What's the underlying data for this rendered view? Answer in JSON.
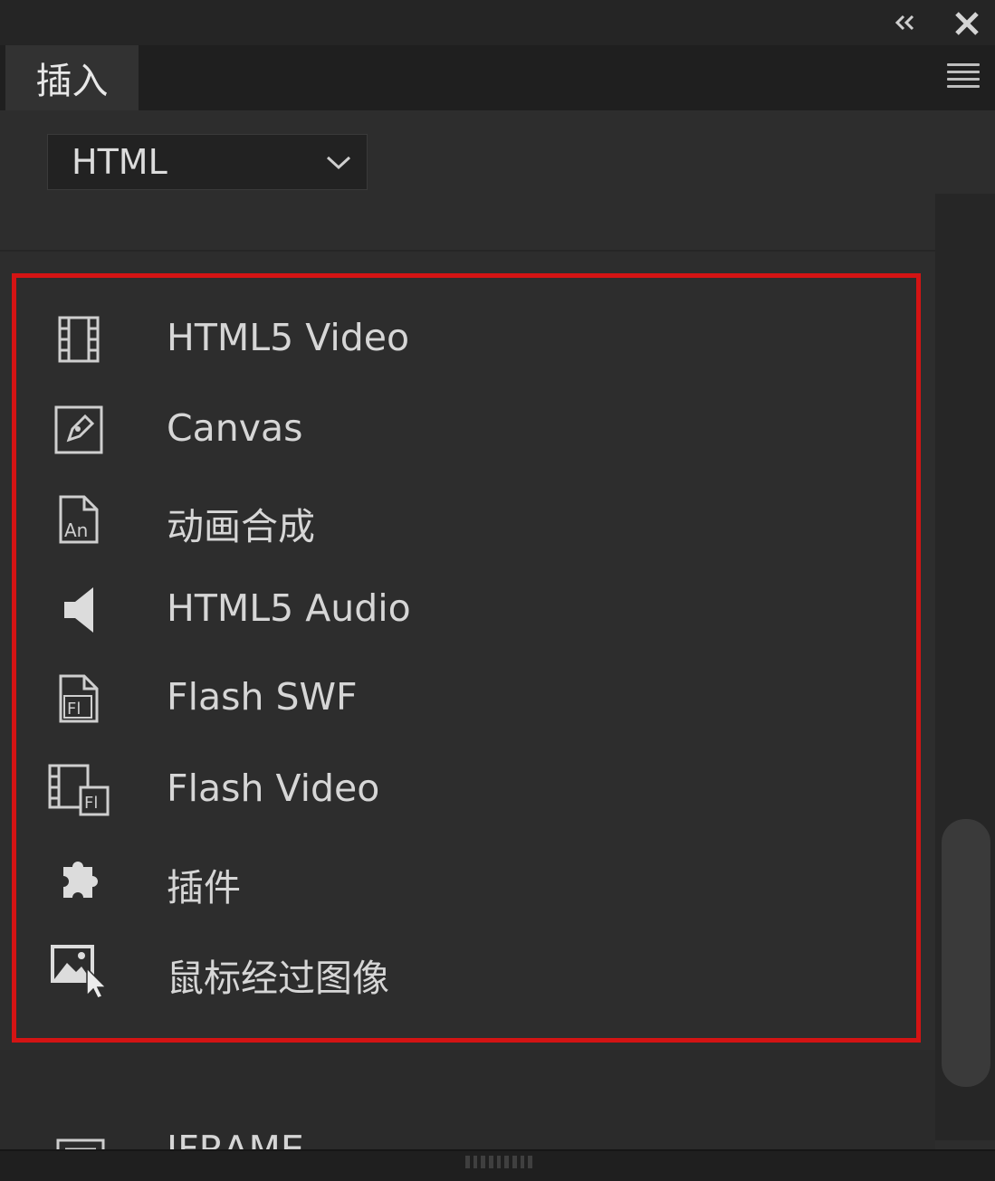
{
  "panel": {
    "tab_label": "插入",
    "category_select": {
      "value": "HTML"
    }
  },
  "window_controls": {
    "collapse_icon": "double-chevron-left-icon",
    "close_icon": "close-icon",
    "menu_icon": "hamburger-menu-icon"
  },
  "items": [
    {
      "label": "HTML5 Video",
      "icon": "film-icon"
    },
    {
      "label": "Canvas",
      "icon": "pen-canvas-icon"
    },
    {
      "label": "动画合成",
      "icon": "animate-file-icon"
    },
    {
      "label": "HTML5 Audio",
      "icon": "speaker-icon"
    },
    {
      "label": "Flash SWF",
      "icon": "flash-file-icon"
    },
    {
      "label": "Flash Video",
      "icon": "flash-video-icon"
    },
    {
      "label": "插件",
      "icon": "puzzle-plugin-icon"
    },
    {
      "label": "鼠标经过图像",
      "icon": "rollover-image-icon"
    }
  ],
  "partial_item": {
    "label": "IFRAME",
    "icon": "iframe-icon"
  },
  "colors": {
    "highlight": "#d41414",
    "panel_bg": "#2d2d2d",
    "text": "#d6d6d6"
  }
}
